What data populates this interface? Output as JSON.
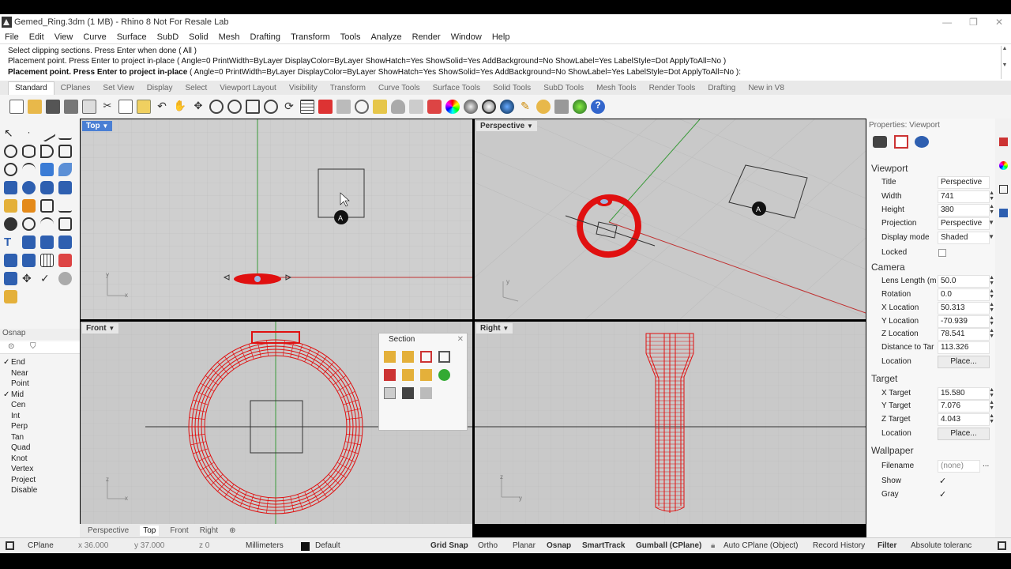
{
  "window": {
    "title": "Gemed_Ring.3dm (1 MB) - Rhino 8 Not For Resale Lab",
    "controls": [
      "—",
      "❐",
      "✕"
    ]
  },
  "menu": [
    "File",
    "Edit",
    "View",
    "Curve",
    "Surface",
    "SubD",
    "Solid",
    "Mesh",
    "Drafting",
    "Transform",
    "Tools",
    "Analyze",
    "Render",
    "Window",
    "Help"
  ],
  "command": {
    "line1": "Select clipping sections. Press Enter when done ( All )",
    "line2": "Placement point. Press Enter to project in-place ( Angle=0  PrintWidth=ByLayer  DisplayColor=ByLayer  ShowHatch=Yes  ShowSolid=Yes  AddBackground=No  ShowLabel=Yes  LabelStyle=Dot  ApplyToAll=No )",
    "prompt_bold": "Placement point. Press Enter to project in-place",
    "prompt_rest": " ( Angle=0  PrintWidth=ByLayer  DisplayColor=ByLayer  ShowHatch=Yes  ShowSolid=Yes  AddBackground=No  ShowLabel=Yes  LabelStyle=Dot  ApplyToAll=No ):"
  },
  "toolbar_tabs": [
    "Standard",
    "CPlanes",
    "Set View",
    "Display",
    "Select",
    "Viewport Layout",
    "Visibility",
    "Transform",
    "Curve Tools",
    "Surface Tools",
    "Solid Tools",
    "SubD Tools",
    "Mesh Tools",
    "Render Tools",
    "Drafting",
    "New in V8"
  ],
  "active_toolbar_tab": "Standard",
  "viewports": {
    "top": "Top",
    "perspective": "Perspective",
    "front": "Front",
    "right": "Right"
  },
  "viewport_tabs": [
    "Perspective",
    "Top",
    "Front",
    "Right"
  ],
  "active_viewport_tab": "Top",
  "section_panel": {
    "title": "Section"
  },
  "osnap": {
    "title": "Osnap",
    "items": [
      {
        "label": "End",
        "checked": true
      },
      {
        "label": "Near",
        "checked": false
      },
      {
        "label": "Point",
        "checked": false
      },
      {
        "label": "Mid",
        "checked": true
      },
      {
        "label": "Cen",
        "checked": false
      },
      {
        "label": "Int",
        "checked": false
      },
      {
        "label": "Perp",
        "checked": false
      },
      {
        "label": "Tan",
        "checked": false
      },
      {
        "label": "Quad",
        "checked": false
      },
      {
        "label": "Knot",
        "checked": false
      },
      {
        "label": "Vertex",
        "checked": false
      },
      {
        "label": "Project",
        "checked": false
      },
      {
        "label": "Disable",
        "checked": false
      }
    ]
  },
  "properties": {
    "header": "Properties: Viewport",
    "viewport_section": "Viewport",
    "title_label": "Title",
    "title_value": "Perspective",
    "width_label": "Width",
    "width_value": "741",
    "height_label": "Height",
    "height_value": "380",
    "projection_label": "Projection",
    "projection_value": "Perspective",
    "display_label": "Display mode",
    "display_value": "Shaded",
    "locked_label": "Locked",
    "camera_section": "Camera",
    "lens_label": "Lens Length (m",
    "lens_value": "50.0",
    "rotation_label": "Rotation",
    "rotation_value": "0.0",
    "xloc_label": "X Location",
    "xloc_value": "50.313",
    "yloc_label": "Y Location",
    "yloc_value": "-70.939",
    "zloc_label": "Z Location",
    "zloc_value": "78.541",
    "dist_label": "Distance to Tar",
    "dist_value": "113.326",
    "location_label": "Location",
    "place_button": "Place...",
    "target_section": "Target",
    "xt_label": "X Target",
    "xt_value": "15.580",
    "yt_label": "Y Target",
    "yt_value": "7.076",
    "zt_label": "Z Target",
    "zt_value": "4.043",
    "tlocation_label": "Location",
    "tplace_button": "Place...",
    "wallpaper_section": "Wallpaper",
    "filename_label": "Filename",
    "filename_value": "(none)",
    "browse": "...",
    "show_label": "Show",
    "gray_label": "Gray"
  },
  "status": {
    "cplane": "CPlane",
    "x": "x 36.000",
    "y": "y 37.000",
    "z": "z 0",
    "units": "Millimeters",
    "layer": "Default",
    "grid_snap": "Grid Snap",
    "ortho": "Ortho",
    "planar": "Planar",
    "osnap": "Osnap",
    "smarttrack": "SmartTrack",
    "gumball": "Gumball (CPlane)",
    "autocplane": "Auto CPlane (Object)",
    "record": "Record History",
    "filter": "Filter",
    "tolerance": "Absolute toleranc"
  },
  "colors": {
    "ring": "#e01010",
    "accent": "#4a7fd4",
    "viewport_bg": "#c9c9c9"
  }
}
